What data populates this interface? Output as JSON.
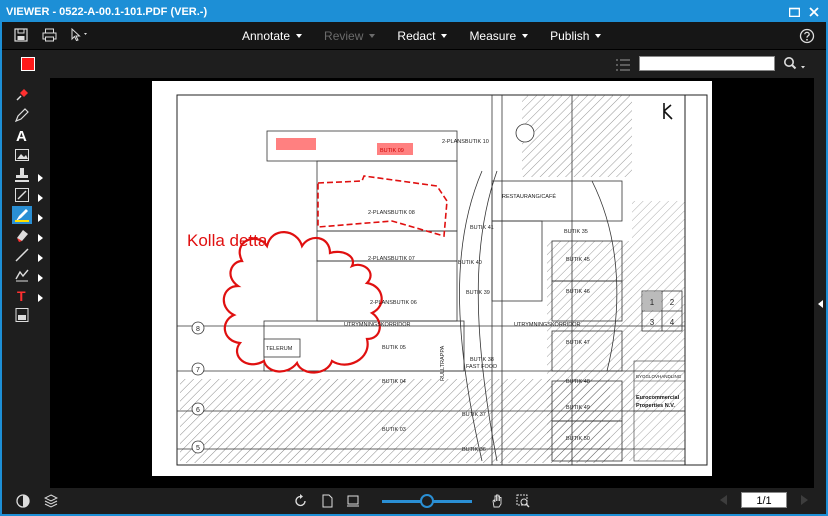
{
  "window": {
    "title": "VIEWER - 0522-A-00.1-101.PDF (VER.-)"
  },
  "toolbar": {
    "menus": [
      {
        "label": "Annotate",
        "enabled": true
      },
      {
        "label": "Review",
        "enabled": false
      },
      {
        "label": "Redact",
        "enabled": true
      },
      {
        "label": "Measure",
        "enabled": true
      },
      {
        "label": "Publish",
        "enabled": true
      }
    ]
  },
  "annotation_color": "#ff1a1a",
  "accent_color": "#1d8fd6",
  "search": {
    "value": ""
  },
  "sidebar_tools": [
    "pushpin-icon",
    "pen-icon",
    "text-icon",
    "image-icon",
    "stamp-icon",
    "attachment-icon",
    "highlighter-icon",
    "eraser-icon",
    "line-icon",
    "polygon-icon",
    "text-markup-icon",
    "signature-icon"
  ],
  "drawing": {
    "comment": "Kolla detta",
    "highlight_labels": [
      "BUTIK 09"
    ],
    "labels": {
      "plansbutik_10": "2-PLANSBUTIK 10",
      "plansbutik_08": "2-PLANSBUTIK 08",
      "plansbutik_07": "2-PLANSBUTIK 07",
      "plansbutik_06": "2-PLANSBUTIK 06",
      "restaurang": "RESTAURANG/CAFÉ",
      "butik41": "BUTIK 41",
      "butik40": "BUTIK 40",
      "butik39": "BUTIK 39",
      "butik38": "BUTIK 38",
      "fastfood": "FAST FOOD",
      "butik37": "BUTIK 37",
      "butik36": "BUTIK 36",
      "butik35": "BUTIK 35",
      "butik34": "BUTIK 34",
      "butik05": "BUTIK 05",
      "butik04": "BUTIK 04",
      "butik03": "BUTIK 03",
      "butik45": "BUTIK 45",
      "butik46": "BUTIK 46",
      "butik47": "BUTIK 47",
      "butik48": "BUTIK 48",
      "butik49": "BUTIK 49",
      "butik50": "BUTIK 50",
      "utrymning1": "UTRYMNINGSKORRIDOR",
      "utrymning2": "UTRYMNINGSKORRIDOR",
      "telerum": "TELERUM",
      "rulltrappa": "RULLTRAPPA",
      "grid8": "8",
      "grid7": "7",
      "grid6": "6",
      "grid5": "5",
      "key1": "1",
      "key2": "2",
      "key3": "3",
      "key4": "4",
      "bygglov": "BYGGLOVHANDLING",
      "company1": "Eurocommercial",
      "company2": "Properties N.V."
    }
  },
  "pager": {
    "current": "1/1"
  },
  "zoom": {
    "level_fraction": 0.5
  }
}
